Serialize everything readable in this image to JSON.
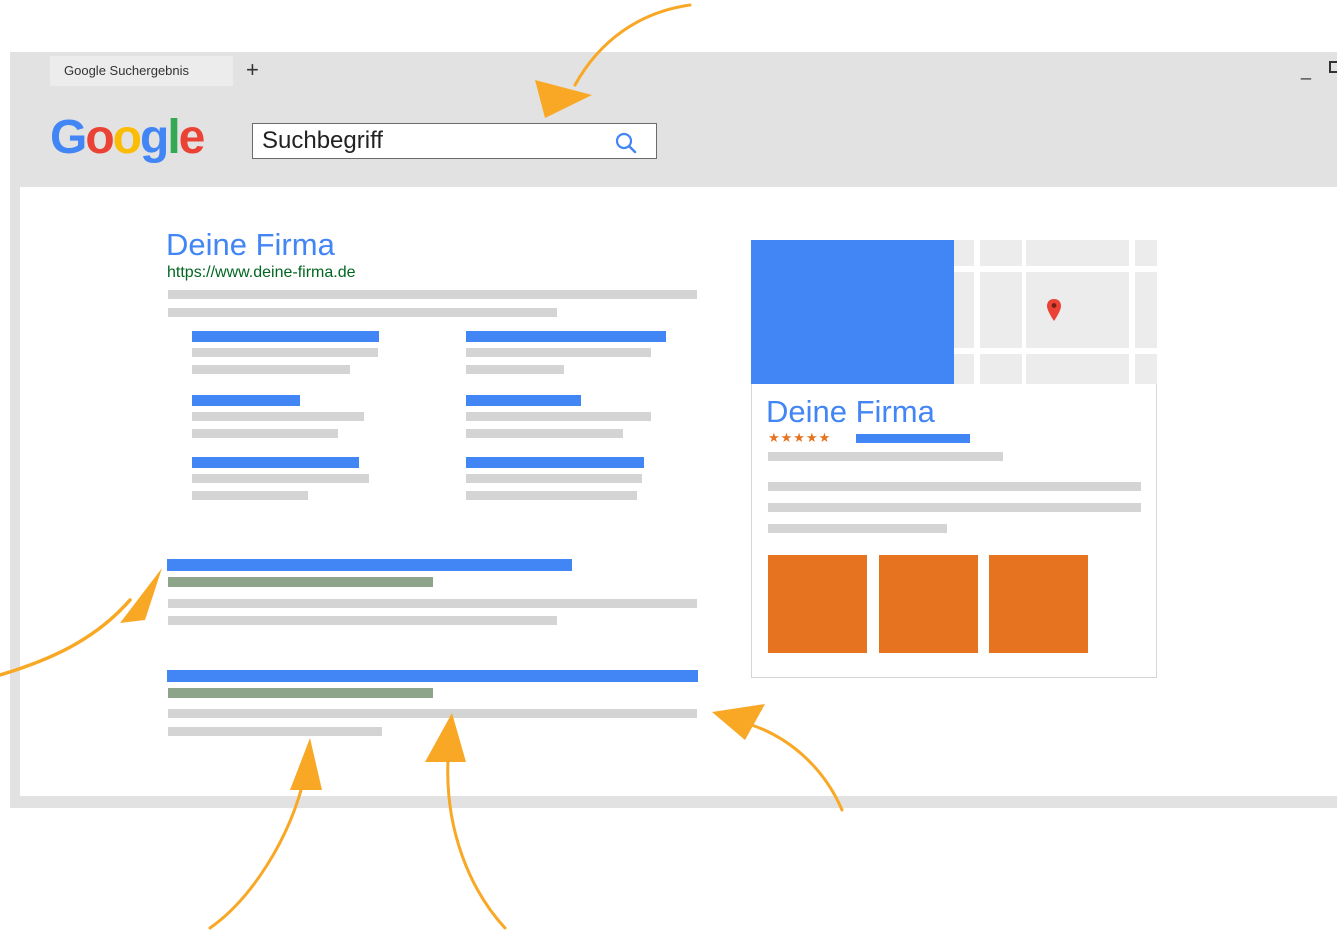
{
  "browser": {
    "tab_title": "Google Suchergebnis",
    "new_tab_symbol": "+",
    "minimize_symbol": "_"
  },
  "search": {
    "logo_letters": [
      "G",
      "o",
      "o",
      "g",
      "l",
      "e"
    ],
    "logo_colors": [
      "#4285f4",
      "#ea4335",
      "#fbbc05",
      "#4285f4",
      "#34a853",
      "#ea4335"
    ],
    "query": "Suchbegriff"
  },
  "result": {
    "title": "Deine Firma",
    "url": "https://www.deine-firma.de"
  },
  "knowledge_panel": {
    "title": "Deine Firma",
    "rating_stars": "★★★★★"
  },
  "colors": {
    "link_blue": "#4285f4",
    "url_green": "#006621",
    "snippet_grey": "#d4d4d4",
    "accent_orange": "#e67320",
    "arrow_yellow": "#f9a825"
  }
}
